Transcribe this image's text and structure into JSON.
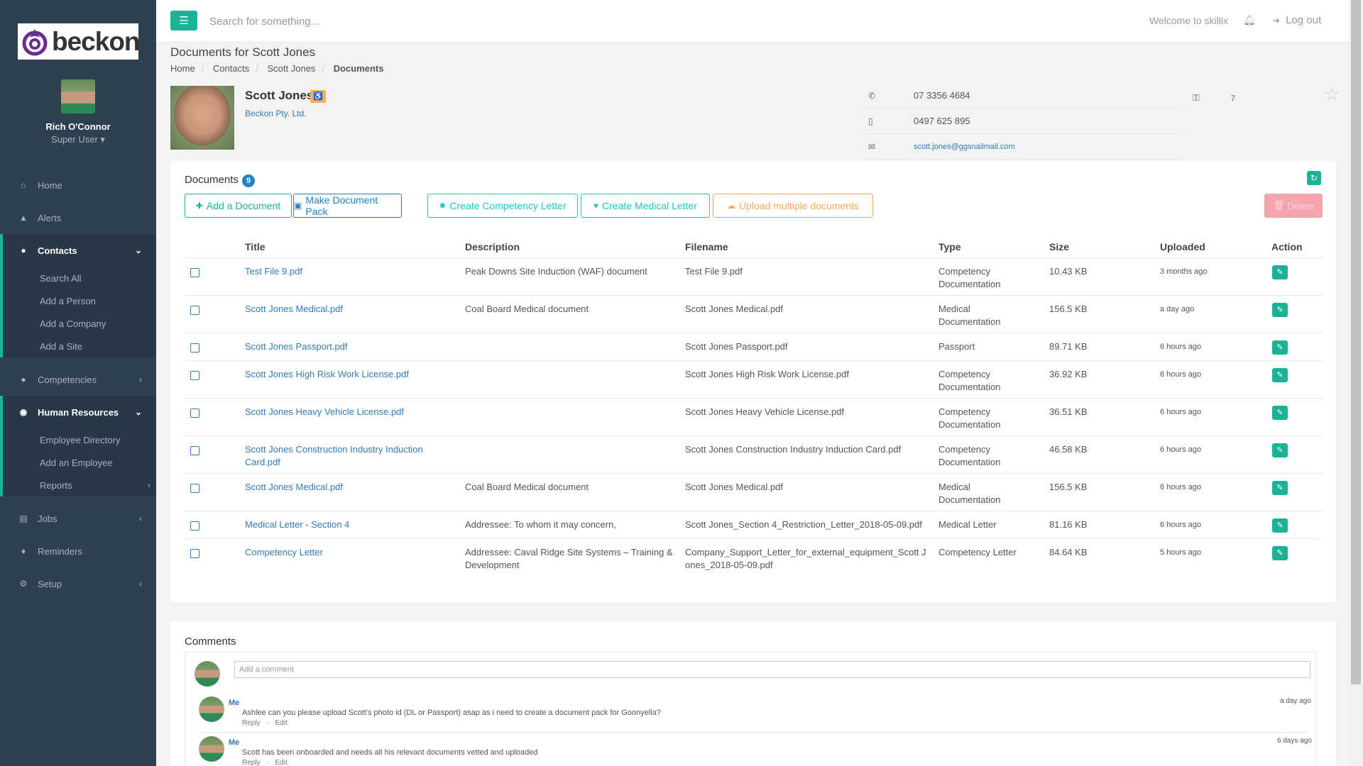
{
  "brand": {
    "name": "beckon"
  },
  "profile": {
    "name": "Rich O'Connor",
    "role": "Super User ▾"
  },
  "nav": {
    "home": "Home",
    "alerts": "Alerts",
    "contacts": "Contacts",
    "contacts_sub": [
      "Search All",
      "Add a Person",
      "Add a Company",
      "Add a Site"
    ],
    "competencies": "Competencies",
    "hr": "Human Resources",
    "hr_sub": [
      "Employee Directory",
      "Add an Employee",
      "Reports"
    ],
    "jobs": "Jobs",
    "reminders": "Reminders",
    "setup": "Setup"
  },
  "topbar": {
    "search_placeholder": "Search for something...",
    "welcome": "Welcome to skillix",
    "logout": "Log out"
  },
  "page": {
    "title": "Documents for Scott Jones"
  },
  "breadcrumb": [
    "Home",
    "Contacts",
    "Scott Jones",
    "Documents"
  ],
  "contact": {
    "name": "Scott Jones",
    "company": "Beckon Pty. Ltd.",
    "phone": "07 3356 4684",
    "mobile": "0497 625 895",
    "email": "scott.jones@ggsnailmail.com",
    "key_count": "7"
  },
  "documents": {
    "title": "Documents",
    "count": "9",
    "buttons": {
      "add": "Add a Document",
      "pack": "Make Document Pack",
      "competency": "Create Competency Letter",
      "medical": "Create Medical Letter",
      "upload": "Upload multiple documents",
      "delete": "Delete"
    },
    "columns": [
      "Title",
      "Description",
      "Filename",
      "Type",
      "Size",
      "Uploaded",
      "Action"
    ],
    "rows": [
      {
        "title": "Test File 9.pdf",
        "description": "Peak Downs Site Induction (WAF) document",
        "filename": "Test File 9.pdf",
        "type": "Competency Documentation",
        "size": "10.43 KB",
        "uploaded": "3 months ago"
      },
      {
        "title": "Scott Jones Medical.pdf",
        "description": "Coal Board Medical document",
        "filename": "Scott Jones Medical.pdf",
        "type": "Medical Documentation",
        "size": "156.5 KB",
        "uploaded": "a day ago"
      },
      {
        "title": "Scott Jones Passport.pdf",
        "description": "",
        "filename": "Scott Jones Passport.pdf",
        "type": "Passport",
        "size": "89.71 KB",
        "uploaded": "6 hours ago"
      },
      {
        "title": "Scott Jones High Risk Work License.pdf",
        "description": "",
        "filename": "Scott Jones High Risk Work License.pdf",
        "type": "Competency Documentation",
        "size": "36.92 KB",
        "uploaded": "6 hours ago"
      },
      {
        "title": "Scott Jones Heavy Vehicle License.pdf",
        "description": "",
        "filename": "Scott Jones Heavy Vehicle License.pdf",
        "type": "Competency Documentation",
        "size": "36.51 KB",
        "uploaded": "6 hours ago"
      },
      {
        "title": "Scott Jones Construction Industry Induction Card.pdf",
        "description": "",
        "filename": "Scott Jones Construction Industry Induction Card.pdf",
        "type": "Competency Documentation",
        "size": "46.58 KB",
        "uploaded": "6 hours ago"
      },
      {
        "title": "Scott Jones Medical.pdf",
        "description": "Coal Board Medical document",
        "filename": "Scott Jones Medical.pdf",
        "type": "Medical Documentation",
        "size": "156.5 KB",
        "uploaded": "6 hours ago"
      },
      {
        "title": "Medical Letter - Section 4",
        "description": "Addressee: To whom it may concern,",
        "filename": "Scott Jones_Section 4_Restriction_Letter_2018-05-09.pdf",
        "type": "Medical Letter",
        "size": "81.16 KB",
        "uploaded": "6 hours ago"
      },
      {
        "title": "Competency Letter",
        "description": "Addressee: Caval Ridge Site Systems – Training & Development",
        "filename": "Company_Support_Letter_for_external_equipment_Scott Jones_2018-05-09.pdf",
        "type": "Competency Letter",
        "size": "84.64 KB",
        "uploaded": "5 hours ago"
      }
    ]
  },
  "comments": {
    "title": "Comments",
    "placeholder": "Add a comment",
    "reply": "Reply",
    "dot": "·",
    "edit": "Edit",
    "items": [
      {
        "author": "Me",
        "text": "Ashlee can you please upload Scott's photo id (DL or Passport) asap as i need to create a document pack for Goonyella?",
        "time": "a day ago"
      },
      {
        "author": "Me",
        "text": "Scott has been onboarded and needs all his relevant documents vetted and uploaded",
        "time": "6 days ago"
      }
    ]
  },
  "colors": {
    "primary": "#1ab394",
    "sidebar": "#2f4050",
    "link": "#337ab7",
    "warning": "#f8ac59",
    "info": "#23c6c8",
    "success": "#1c84c6",
    "danger": "#f6a4ad"
  }
}
